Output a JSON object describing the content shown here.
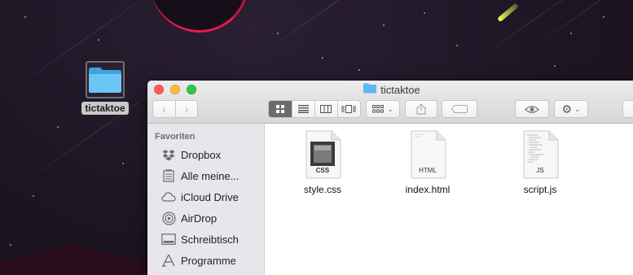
{
  "desktop": {
    "folder_label": "tictaktoe",
    "icons": {
      "folder": "folder-icon"
    }
  },
  "window": {
    "title": "tictaktoe",
    "toolbar": {
      "back_icon": "chevron-left-icon",
      "forward_icon": "chevron-right-icon",
      "view_modes": [
        "icon-view",
        "list-view",
        "column-view",
        "coverflow-view"
      ],
      "active_view": "icon-view"
    }
  },
  "sidebar": {
    "heading": "Favoriten",
    "items": [
      {
        "label": "Dropbox",
        "icon": "dropbox-icon"
      },
      {
        "label": "Alle meine...",
        "icon": "all-files-icon"
      },
      {
        "label": "iCloud Drive",
        "icon": "cloud-icon"
      },
      {
        "label": "AirDrop",
        "icon": "airdrop-icon"
      },
      {
        "label": "Schreibtisch",
        "icon": "desktop-icon"
      },
      {
        "label": "Programme",
        "icon": "applications-icon"
      }
    ]
  },
  "files": [
    {
      "name": "style.css",
      "badge": "CSS",
      "icon": "css-file-icon"
    },
    {
      "name": "index.html",
      "badge": "HTML",
      "icon": "html-file-icon"
    },
    {
      "name": "script.js",
      "badge": "JS",
      "icon": "js-file-icon"
    }
  ],
  "colors": {
    "close": "#fc605c",
    "minimize": "#fdbc40",
    "maximize": "#34c84a",
    "folder_blue": "#5ab8ee"
  }
}
